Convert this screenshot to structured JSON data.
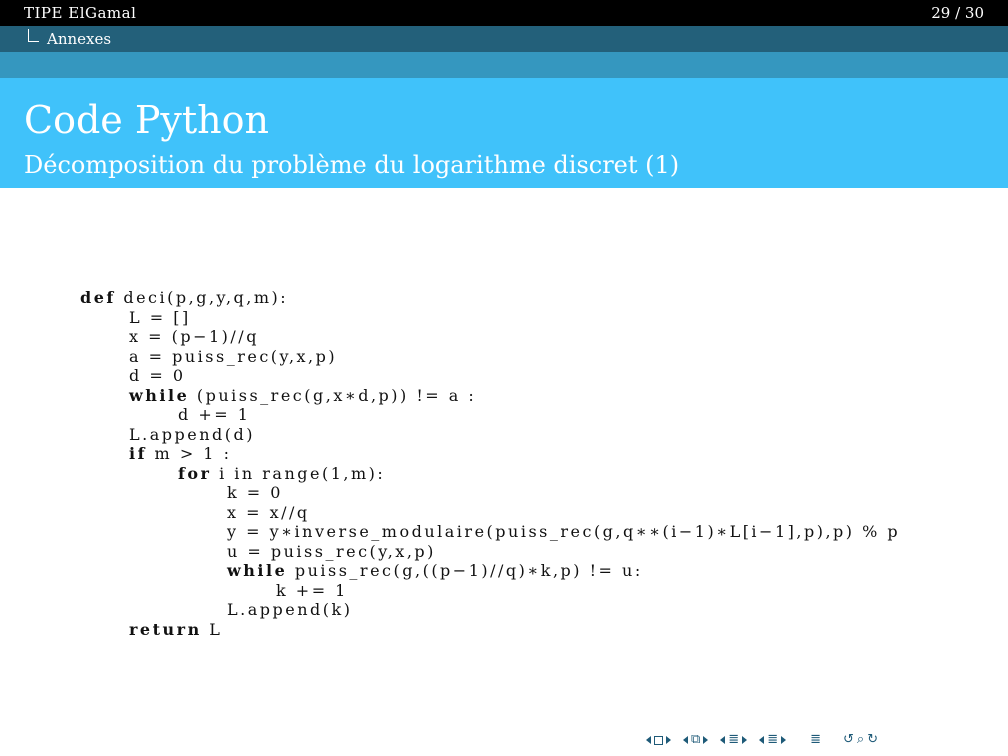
{
  "header": {
    "presentation_title": "TIPE ElGamal",
    "page_indicator": "29 / 30",
    "section": "Annexes"
  },
  "frame": {
    "title": "Code Python",
    "subtitle": "Décomposition du problème du logarithme discret (1)"
  },
  "code": [
    {
      "indent": 0,
      "kw": "def",
      "rest": " deci(p,g,y,q,m):"
    },
    {
      "indent": 1,
      "kw": "",
      "rest": "L = []"
    },
    {
      "indent": 1,
      "kw": "",
      "rest": "x = (p−1)//q"
    },
    {
      "indent": 1,
      "kw": "",
      "rest": "a = puiss_rec(y,x,p)"
    },
    {
      "indent": 1,
      "kw": "",
      "rest": "d = 0"
    },
    {
      "indent": 1,
      "kw": "while",
      "rest": " (puiss_rec(g,x∗d,p)) != a :"
    },
    {
      "indent": 2,
      "kw": "",
      "rest": "d += 1"
    },
    {
      "indent": 1,
      "kw": "",
      "rest": "L.append(d)"
    },
    {
      "indent": 1,
      "kw": "if",
      "rest": " m > 1 :"
    },
    {
      "indent": 2,
      "kw": "for",
      "rest": " i in range(1,m):"
    },
    {
      "indent": 3,
      "kw": "",
      "rest": "k = 0"
    },
    {
      "indent": 3,
      "kw": "",
      "rest": "x = x//q"
    },
    {
      "indent": 3,
      "kw": "",
      "rest": "y = y∗inverse_modulaire(puiss_rec(g,q∗∗(i−1)∗L[i−1],p),p) % p"
    },
    {
      "indent": 3,
      "kw": "",
      "rest": "u = puiss_rec(y,x,p)"
    },
    {
      "indent": 3,
      "kw": "while",
      "rest": " puiss_rec(g,((p−1)//q)∗k,p) != u:"
    },
    {
      "indent": 4,
      "kw": "",
      "rest": "k += 1"
    },
    {
      "indent": 3,
      "kw": "",
      "rest": "L.append(k)"
    },
    {
      "indent": 1,
      "kw": "return",
      "rest": " L"
    }
  ],
  "navigation": {
    "icons": [
      "frame-nav-icon",
      "subsection-nav-icon",
      "section-nav-icon",
      "section-nav-icon",
      "align-icon",
      "search-icon"
    ],
    "color": "#1e5a78"
  },
  "colors": {
    "headline_bg": "#000000",
    "subline_bg": "#23607a",
    "band_bg": "#3597bf",
    "titlebar_bg": "#40c2fa"
  }
}
